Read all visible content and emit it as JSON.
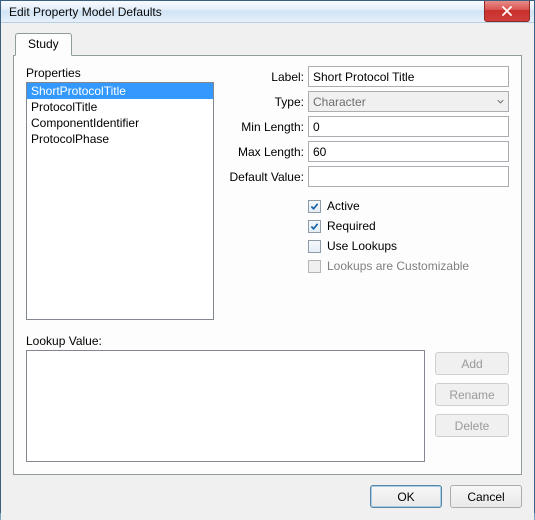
{
  "window": {
    "title": "Edit Property Model Defaults"
  },
  "tabs": [
    {
      "label": "Study"
    }
  ],
  "properties": {
    "header": "Properties",
    "items": [
      {
        "label": "ShortProtocolTitle",
        "selected": true
      },
      {
        "label": "ProtocolTitle",
        "selected": false
      },
      {
        "label": "ComponentIdentifier",
        "selected": false
      },
      {
        "label": "ProtocolPhase",
        "selected": false
      }
    ]
  },
  "form": {
    "label_label": "Label:",
    "label_value": "Short Protocol Title",
    "type_label": "Type:",
    "type_value": "Character",
    "minlen_label": "Min Length:",
    "minlen_value": "0",
    "maxlen_label": "Max Length:",
    "maxlen_value": "60",
    "default_label": "Default Value:",
    "default_value": ""
  },
  "checks": {
    "active": {
      "label": "Active",
      "checked": true,
      "enabled": true
    },
    "required": {
      "label": "Required",
      "checked": true,
      "enabled": true
    },
    "use_lookups": {
      "label": "Use Lookups",
      "checked": false,
      "enabled": true
    },
    "customizable": {
      "label": "Lookups are Customizable",
      "checked": false,
      "enabled": false
    }
  },
  "lookup": {
    "header": "Lookup Value:",
    "buttons": {
      "add": "Add",
      "rename": "Rename",
      "delete": "Delete"
    }
  },
  "dialog_buttons": {
    "ok": "OK",
    "cancel": "Cancel"
  }
}
